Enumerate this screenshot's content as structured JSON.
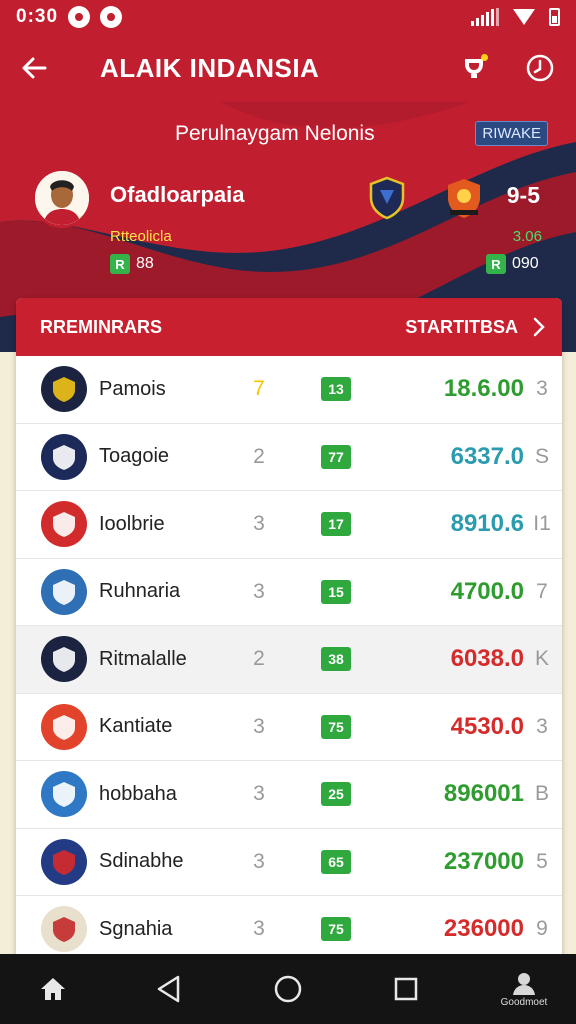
{
  "status_bar": {
    "time": "0:30"
  },
  "app_bar": {
    "title": "ALAIK INDANSIA"
  },
  "hero": {
    "subtitle": "Perulnaygam Nelonis",
    "badge": "RIWAKE",
    "player_name": "Ofadloarpaia",
    "player_sub": "Rtteolicla",
    "chip_left": {
      "badge": "R",
      "value": "88"
    },
    "score": "9-5",
    "change": "3.06",
    "chip_right": {
      "badge": "R",
      "value": "090"
    }
  },
  "card": {
    "header_left": "RREMINRARS",
    "header_right": "STARTITBSA"
  },
  "teams": [
    {
      "name": "Pamois",
      "rank": "7",
      "rank_color": "#f5c400",
      "badge": "13",
      "score": "18.6.00",
      "score_color": "#2e9c2e",
      "extra": "3",
      "logo_bg": "#1b2340",
      "logo_fg": "#f3c316"
    },
    {
      "name": "Toagoie",
      "rank": "2",
      "rank_color": "#999999",
      "badge": "77",
      "score": "6337.0",
      "score_color": "#2b9bb0",
      "extra": "S",
      "logo_bg": "#1c2a5a",
      "logo_fg": "#ffffff"
    },
    {
      "name": "Ioolbrie",
      "rank": "3",
      "rank_color": "#999999",
      "badge": "17",
      "score": "8910.6",
      "score_color": "#2b9bb0",
      "extra": "I1",
      "logo_bg": "#d22b2b",
      "logo_fg": "#ffffff"
    },
    {
      "name": "Ruhnaria",
      "rank": "3",
      "rank_color": "#999999",
      "badge": "15",
      "score": "4700.0",
      "score_color": "#2e9c2e",
      "extra": "7",
      "logo_bg": "#2f6fb5",
      "logo_fg": "#ffffff"
    },
    {
      "name": "Ritmalalle",
      "rank": "2",
      "rank_color": "#999999",
      "badge": "38",
      "score": "6038.0",
      "score_color": "#d62b2b",
      "extra": "K",
      "logo_bg": "#1c2340",
      "logo_fg": "#ffffff"
    },
    {
      "name": "Kantiate",
      "rank": "3",
      "rank_color": "#999999",
      "badge": "75",
      "score": "4530.0",
      "score_color": "#d62b2b",
      "extra": "3",
      "logo_bg": "#e2432a",
      "logo_fg": "#ffffff"
    },
    {
      "name": "hobbaha",
      "rank": "3",
      "rank_color": "#999999",
      "badge": "25",
      "score": "896001",
      "score_color": "#2e9c2e",
      "extra": "B",
      "logo_bg": "#2f78c5",
      "logo_fg": "#ffffff"
    },
    {
      "name": "Sdinabhe",
      "rank": "3",
      "rank_color": "#999999",
      "badge": "65",
      "score": "237000",
      "score_color": "#2e9c2e",
      "extra": "5",
      "logo_bg": "#233a85",
      "logo_fg": "#d82a2a"
    },
    {
      "name": "Sgnahia",
      "rank": "3",
      "rank_color": "#999999",
      "badge": "75",
      "score": "236000",
      "score_color": "#d62b2b",
      "extra": "9",
      "logo_bg": "#e8e0cc",
      "logo_fg": "#c22a2a"
    }
  ],
  "nav": {
    "profile_label": "Goodmoet"
  },
  "colors": {
    "brand_red": "#c11f2f",
    "navy": "#1f2a4a",
    "positive_green": "#2fa83e"
  },
  "icons": [
    "arrow-left-icon",
    "trophy-icon",
    "clock-icon",
    "chevron-right-icon",
    "home-icon",
    "back-triangle-icon",
    "home-circle-icon",
    "recents-square-icon",
    "profile-icon"
  ]
}
